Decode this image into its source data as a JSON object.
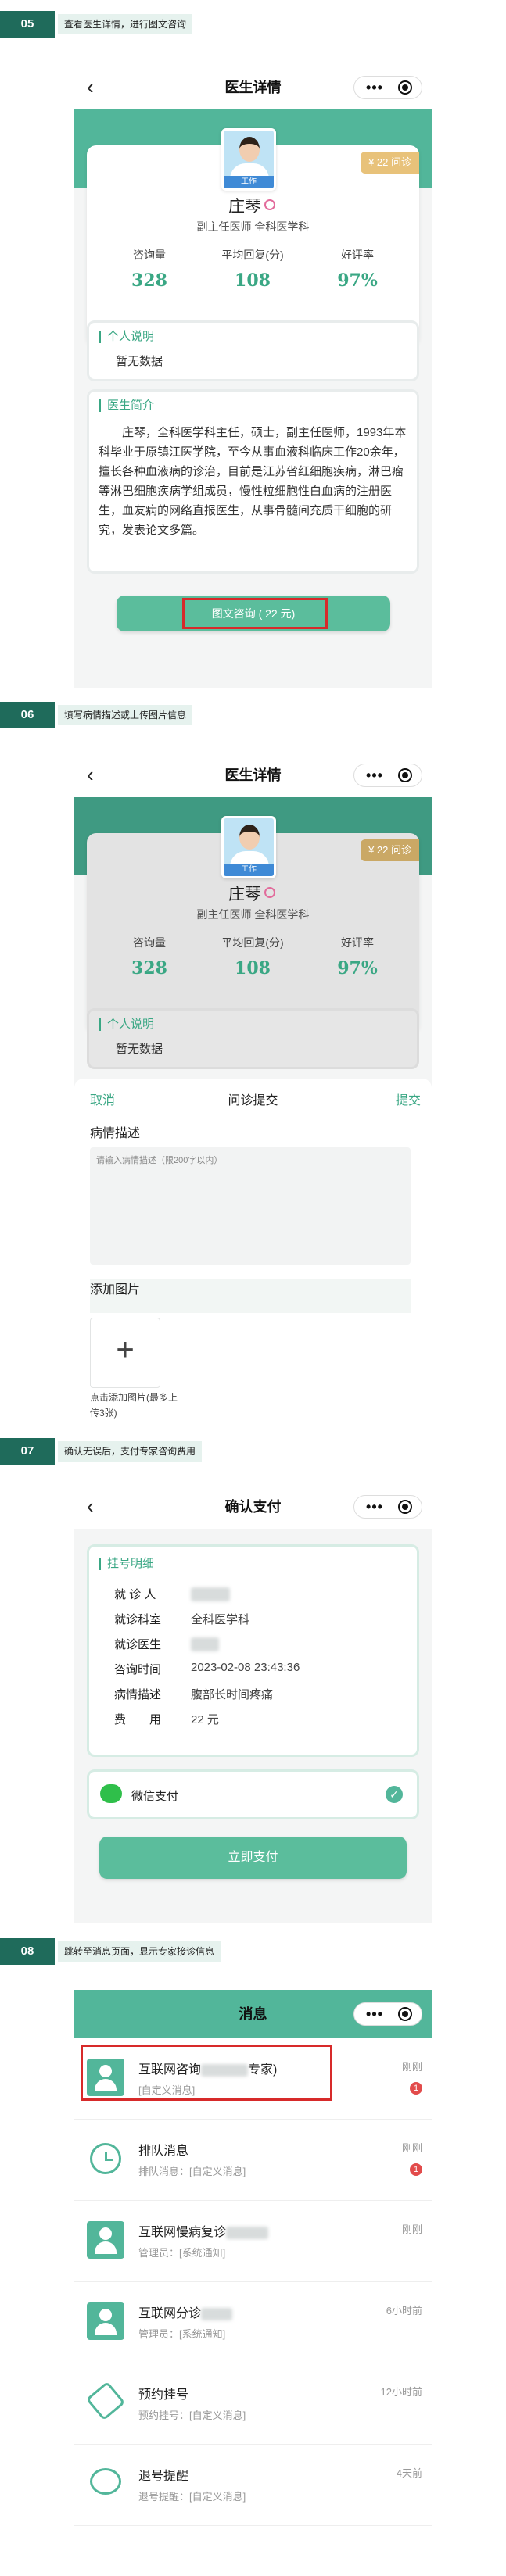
{
  "steps": [
    {
      "num": "05",
      "text": "查看医生详情，进行图文咨询"
    },
    {
      "num": "06",
      "text": "填写病情描述或上传图片信息"
    },
    {
      "num": "07",
      "text": "确认无误后，支付专家咨询费用"
    },
    {
      "num": "08",
      "text": "跳转至消息页面，显示专家接诊信息"
    }
  ],
  "capsule": {
    "dots": "•••"
  },
  "doctor_page": {
    "nav_title": "医生详情",
    "back": "‹",
    "price": "¥ 22 问诊",
    "avatar_tag": "工作",
    "name": "庄琴",
    "title": "副主任医师 全科医学科",
    "stats": [
      {
        "label": "咨询量",
        "value": "328"
      },
      {
        "label": "平均回复(分)",
        "value": "108"
      },
      {
        "label": "好评率",
        "value": "97%"
      }
    ],
    "personal_title": "个人说明",
    "personal_body": "暂无数据",
    "intro_title": "医生简介",
    "intro_body": "庄琴，全科医学科主任，硕士，副主任医师，1993年本科毕业于原镇江医学院，至今从事血液科临床工作20余年，擅长各种血液病的诊治，目前是江苏省红细胞疾病，淋巴瘤等淋巴细胞疾病学组成员，慢性粒细胞性白血病的注册医生，血友病的网络直报医生，从事骨髓间充质干细胞的研究，发表论文多篇。",
    "consult_button": "图文咨询 ( 22 元)"
  },
  "submit_sheet": {
    "cancel": "取消",
    "title": "问诊提交",
    "submit": "提交",
    "desc_label": "病情描述",
    "desc_placeholder": "请输入病情描述（限200字以内）",
    "image_label": "添加图片",
    "plus": "+",
    "upload_hint": "点击添加图片(最多上传3张)"
  },
  "pay_page": {
    "nav_title": "确认支付",
    "section_title": "挂号明细",
    "rows": [
      {
        "label": "就 诊 人",
        "value": ""
      },
      {
        "label": "就诊科室",
        "value": "全科医学科"
      },
      {
        "label": "就诊医生",
        "value": ""
      },
      {
        "label": "咨询时间",
        "value": "2023-02-08 23:43:36"
      },
      {
        "label": "病情描述",
        "value": "腹部长时间疼痛"
      },
      {
        "label": "费　　用",
        "value": "22 元"
      }
    ],
    "wechat_pay": "微信支付",
    "pay_button": "立即支付"
  },
  "msg_page": {
    "nav_title": "消息",
    "items": [
      {
        "title": "互联网咨询",
        "title_tail": "专家)",
        "sub": "[自定义消息]",
        "time": "刚刚",
        "badge": "1"
      },
      {
        "title": "排队消息",
        "sub": "排队消息：[自定义消息]",
        "time": "刚刚",
        "badge": "1"
      },
      {
        "title": "互联网慢病复诊",
        "sub": "管理员：[系统通知]",
        "time": "刚刚",
        "badge": ""
      },
      {
        "title": "互联网分诊",
        "sub": "管理员：[系统通知]",
        "time": "6小时前",
        "badge": ""
      },
      {
        "title": "预约挂号",
        "sub": "预约挂号：[自定义消息]",
        "time": "12小时前",
        "badge": ""
      },
      {
        "title": "退号提醒",
        "sub": "退号提醒：[自定义消息]",
        "time": "4天前",
        "badge": ""
      }
    ]
  },
  "colors": {
    "accent": "#52b69a",
    "stat": "#3aa784",
    "price": "#e8c27a",
    "highlight": "#d72a2a",
    "step": "#1f6b5b"
  }
}
